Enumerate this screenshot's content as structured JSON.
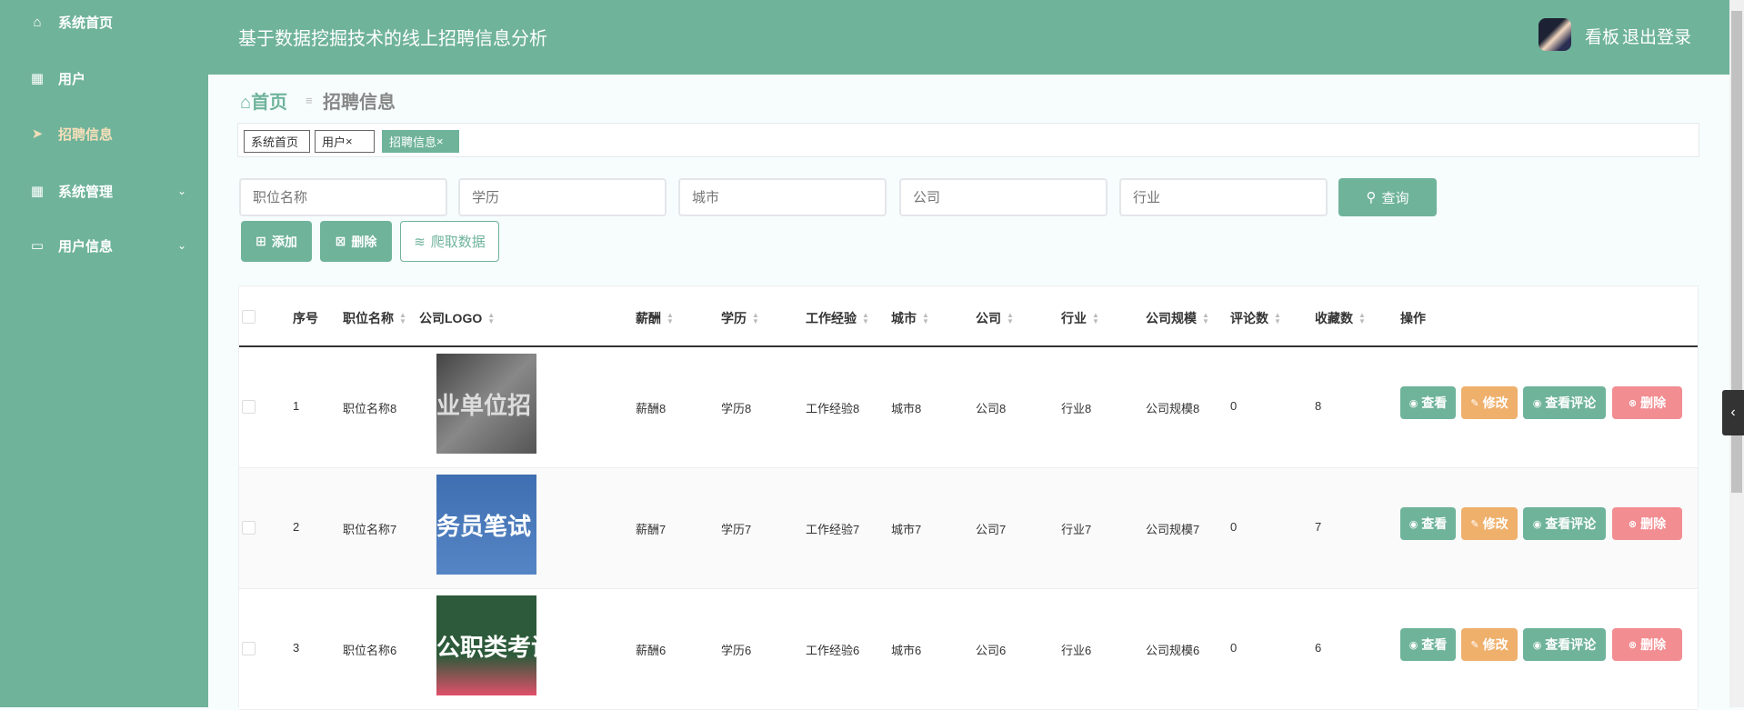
{
  "sidebar": {
    "items": [
      {
        "label": "系统首页",
        "icon": "home-icon"
      },
      {
        "label": "用户",
        "icon": "grid-icon"
      },
      {
        "label": "招聘信息",
        "icon": "paper-plane-icon"
      },
      {
        "label": "系统管理",
        "icon": "grid-icon"
      },
      {
        "label": "用户信息",
        "icon": "card-icon"
      }
    ]
  },
  "header": {
    "title": "基于数据挖掘技术的线上招聘信息分析",
    "board": "看板",
    "logout": "退出登录"
  },
  "breadcrumb": {
    "home": "首页",
    "sep": "≡",
    "current": "招聘信息"
  },
  "tabs": [
    {
      "label": "系统首页",
      "close": ""
    },
    {
      "label": "用户",
      "close": "×"
    },
    {
      "label": "招聘信息",
      "close": "×"
    }
  ],
  "search": {
    "placeholders": [
      "职位名称",
      "学历",
      "城市",
      "公司",
      "行业"
    ],
    "query": "查询"
  },
  "actions": {
    "add": "添加",
    "delete": "删除",
    "crawl": "爬取数据"
  },
  "table": {
    "headers": [
      "序号",
      "职位名称",
      "公司LOGO",
      "薪酬",
      "学历",
      "工作经验",
      "城市",
      "公司",
      "行业",
      "公司规模",
      "评论数",
      "收藏数",
      "操作"
    ],
    "rows": [
      {
        "no": "1",
        "name": "职位名称8",
        "logo": "业单位招",
        "salary": "薪酬8",
        "edu": "学历8",
        "exp": "工作经验8",
        "city": "城市8",
        "company": "公司8",
        "industry": "行业8",
        "size": "公司规模8",
        "comments": "0",
        "favs": "8"
      },
      {
        "no": "2",
        "name": "职位名称7",
        "logo": "务员笔试",
        "salary": "薪酬7",
        "edu": "学历7",
        "exp": "工作经验7",
        "city": "城市7",
        "company": "公司7",
        "industry": "行业7",
        "size": "公司规模7",
        "comments": "0",
        "favs": "7"
      },
      {
        "no": "3",
        "name": "职位名称6",
        "logo": "公职类考试",
        "salary": "薪酬6",
        "edu": "学历6",
        "exp": "工作经验6",
        "city": "城市6",
        "company": "公司6",
        "industry": "行业6",
        "size": "公司规模6",
        "comments": "0",
        "favs": "6"
      }
    ],
    "row_actions": {
      "view": "查看",
      "edit": "修改",
      "comments": "查看评论",
      "delete": "删除"
    }
  },
  "colors": {
    "primary": "#6fb39b",
    "warning": "#efb06c",
    "danger": "#f28d92",
    "active_menu": "#f5dfb9"
  }
}
